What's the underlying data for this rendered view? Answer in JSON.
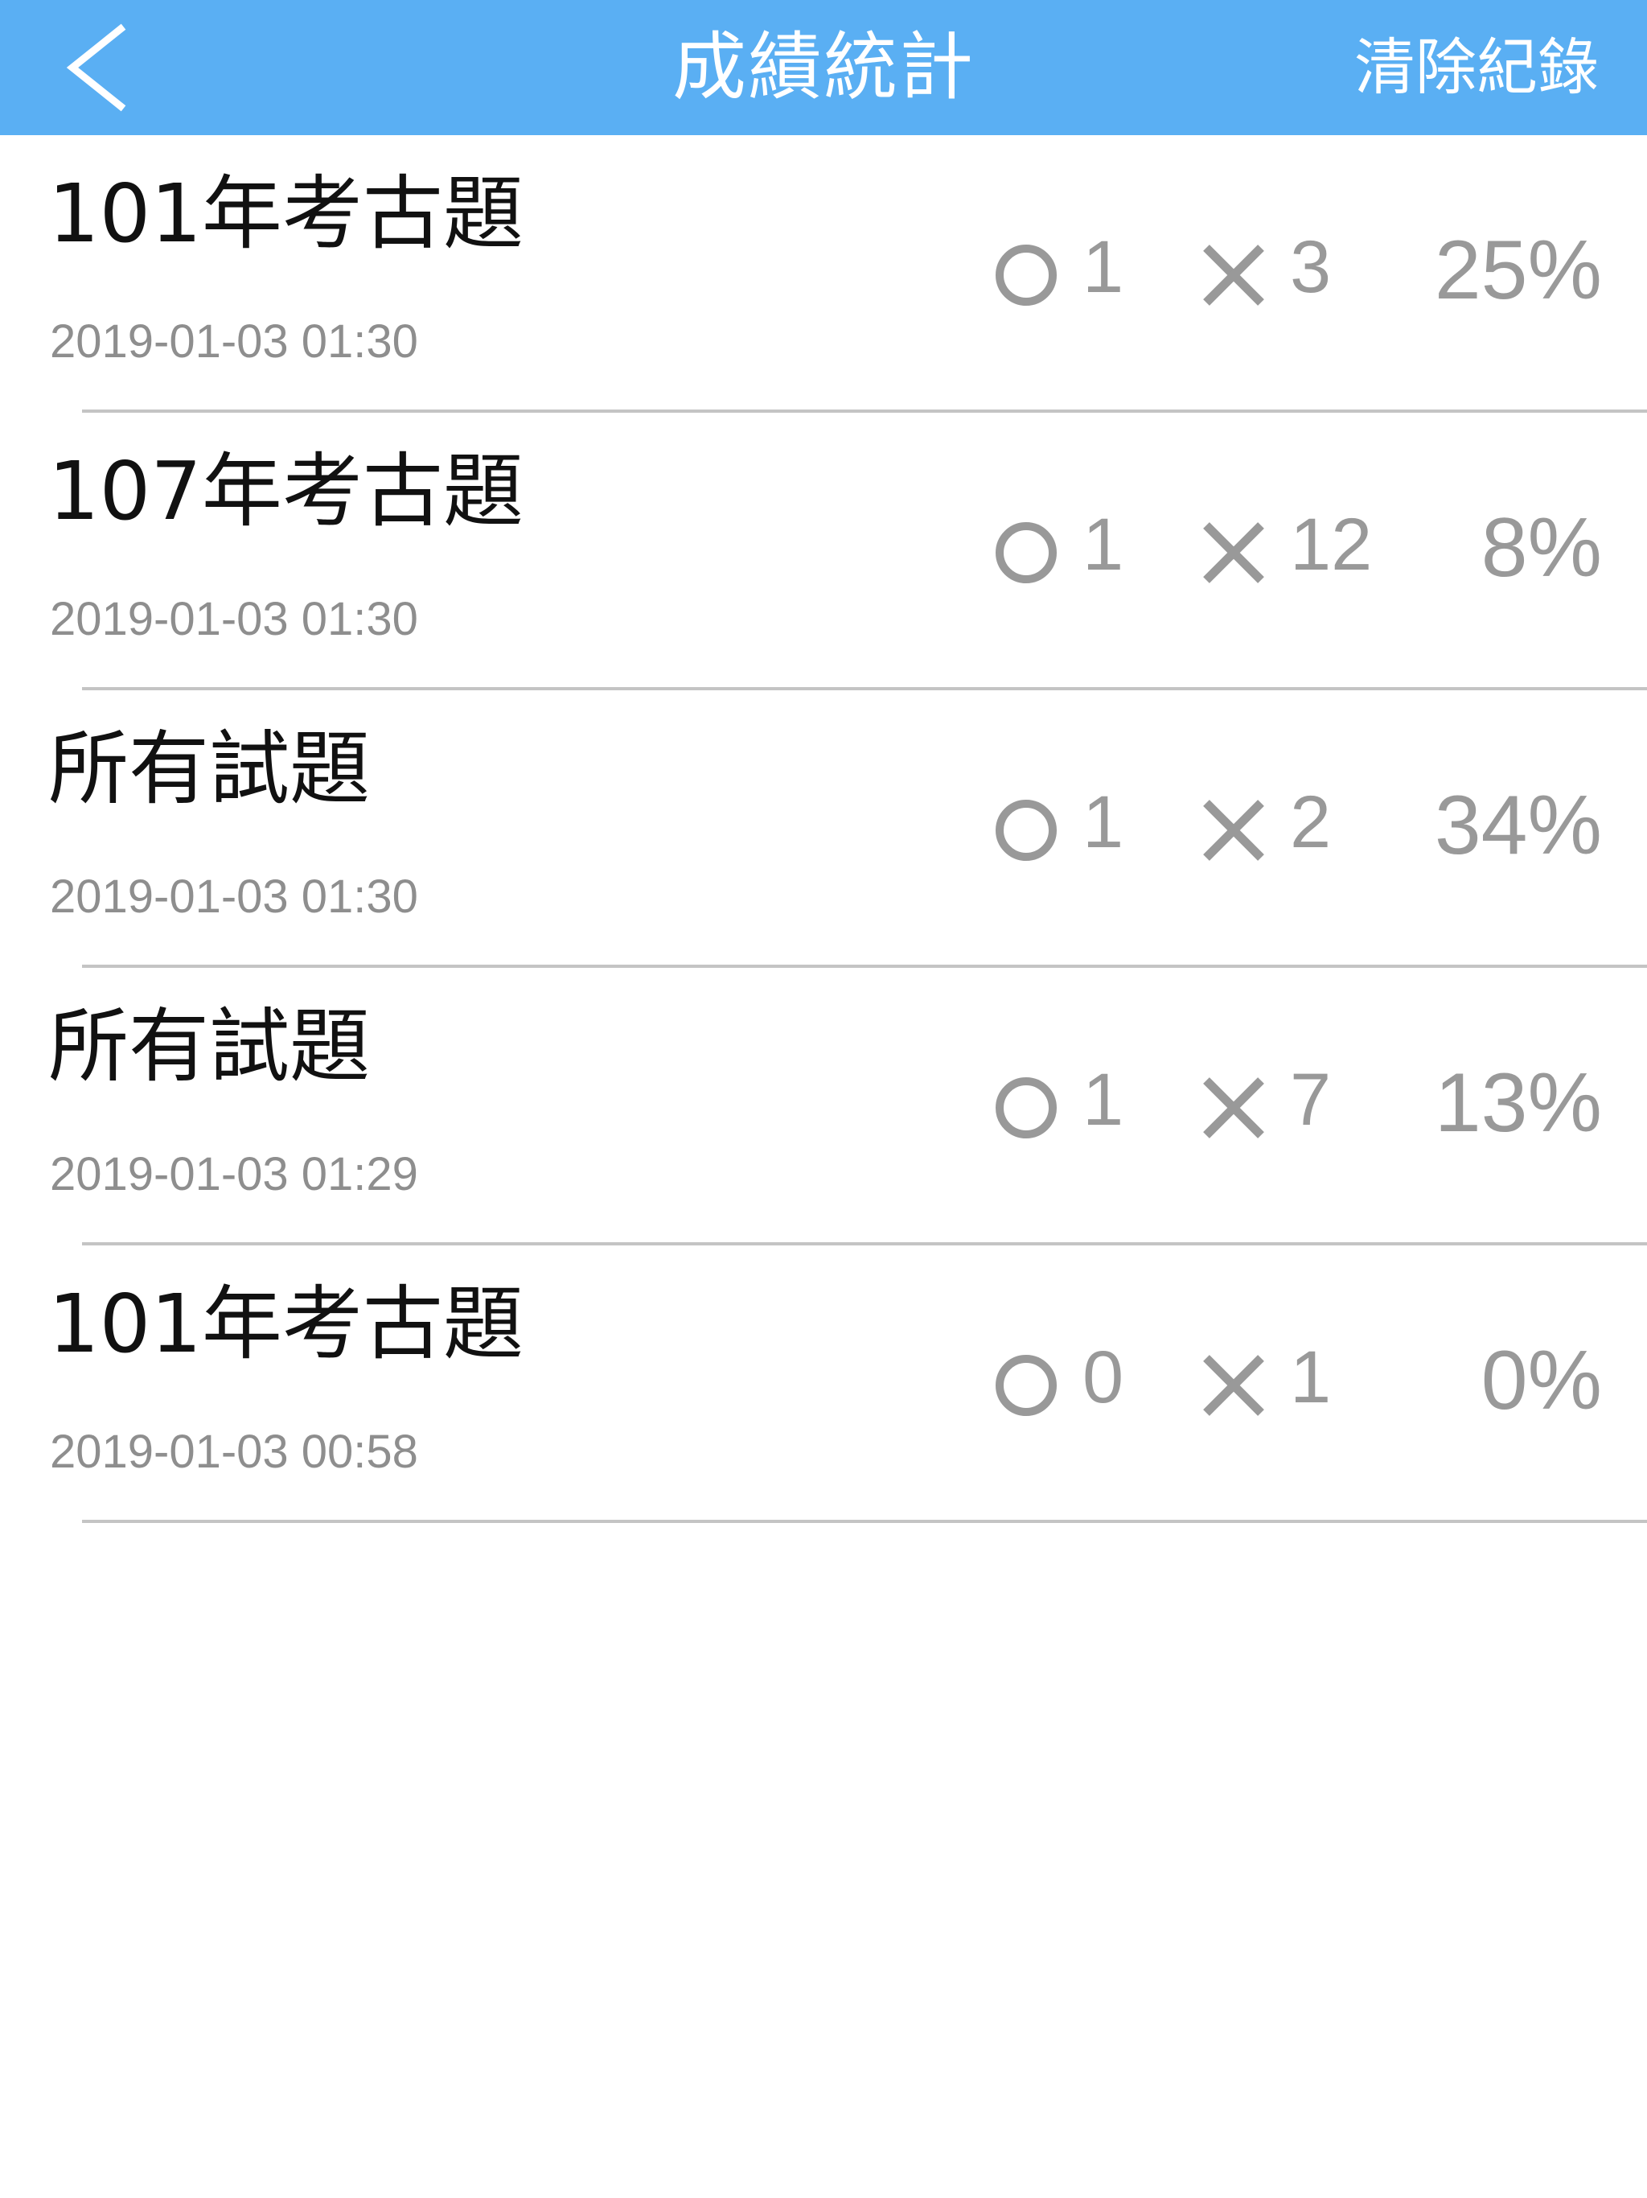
{
  "navbar": {
    "title": "成績統計",
    "clear_label": "清除紀錄",
    "back_icon": "chevron-left-icon",
    "background_color": "#5aaff3"
  },
  "records": [
    {
      "title": "101年考古題",
      "time": "2019-01-03 01:30",
      "correct": "1",
      "wrong": "3",
      "percent": "25%"
    },
    {
      "title": "107年考古題",
      "time": "2019-01-03 01:30",
      "correct": "1",
      "wrong": "12",
      "percent": "8%"
    },
    {
      "title": "所有試題",
      "time": "2019-01-03 01:30",
      "correct": "1",
      "wrong": "2",
      "percent": "34%"
    },
    {
      "title": "所有試題",
      "time": "2019-01-03 01:29",
      "correct": "1",
      "wrong": "7",
      "percent": "13%"
    },
    {
      "title": "101年考古題",
      "time": "2019-01-03 00:58",
      "correct": "0",
      "wrong": "1",
      "percent": "0%"
    }
  ]
}
